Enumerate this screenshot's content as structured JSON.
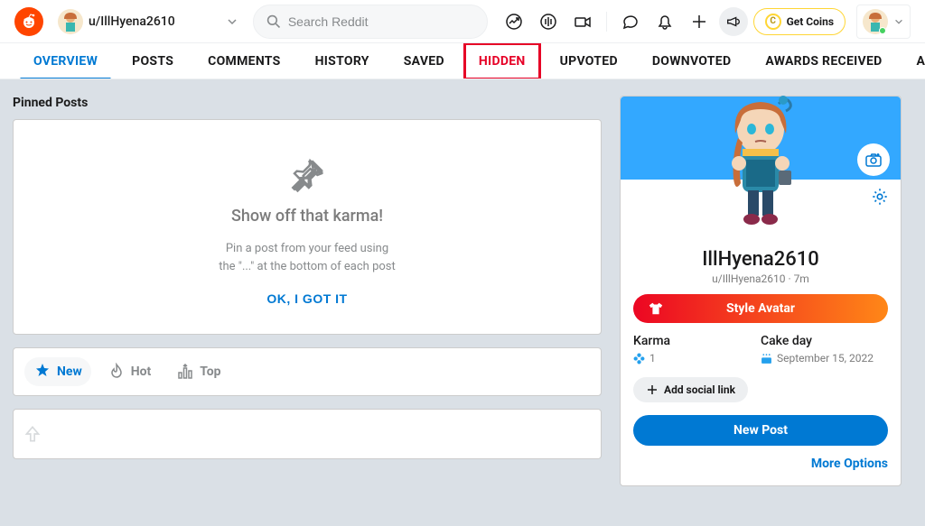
{
  "header": {
    "username_display": "u/IllHyena2610",
    "search_placeholder": "Search Reddit",
    "get_coins_label": "Get Coins"
  },
  "tabs": [
    {
      "label": "OVERVIEW",
      "active": true
    },
    {
      "label": "POSTS"
    },
    {
      "label": "COMMENTS"
    },
    {
      "label": "HISTORY"
    },
    {
      "label": "SAVED"
    },
    {
      "label": "HIDDEN",
      "highlighted": true
    },
    {
      "label": "UPVOTED"
    },
    {
      "label": "DOWNVOTED"
    },
    {
      "label": "AWARDS RECEIVED"
    },
    {
      "label": "AWARDS GIVEN"
    }
  ],
  "pinned": {
    "section_title": "Pinned Posts",
    "heading": "Show off that karma!",
    "text_line1": "Pin a post from your feed using",
    "text_line2": "the \"...\" at the bottom of each post",
    "ok_label": "OK, I GOT IT"
  },
  "sort": {
    "new": "New",
    "hot": "Hot",
    "top": "Top"
  },
  "sidebar": {
    "display_name": "IllHyena2610",
    "handle": "u/IllHyena2610 · 7m",
    "style_avatar_label": "Style Avatar",
    "karma_label": "Karma",
    "karma_value": "1",
    "cakeday_label": "Cake day",
    "cakeday_value": "September 15, 2022",
    "add_social_label": "Add social link",
    "new_post_label": "New Post",
    "more_options_label": "More Options"
  }
}
